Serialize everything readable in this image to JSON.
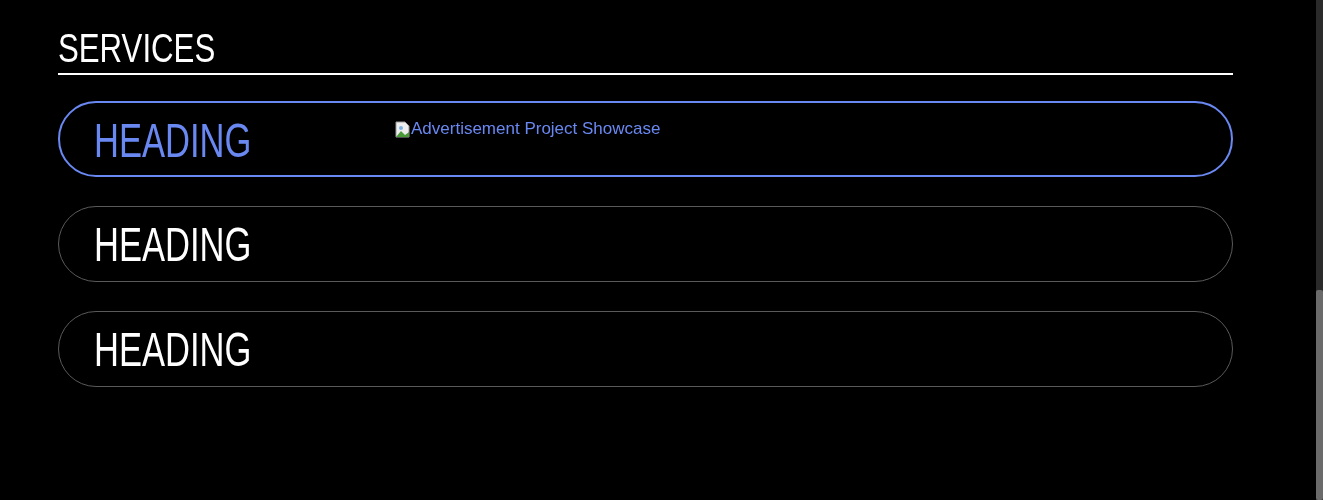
{
  "section": {
    "title": "SERVICES"
  },
  "cards": [
    {
      "heading": "HEADING",
      "selected": true,
      "image_alt": "Advertisement Project Showcase"
    },
    {
      "heading": "HEADING",
      "selected": false
    },
    {
      "heading": "HEADING",
      "selected": false
    }
  ]
}
